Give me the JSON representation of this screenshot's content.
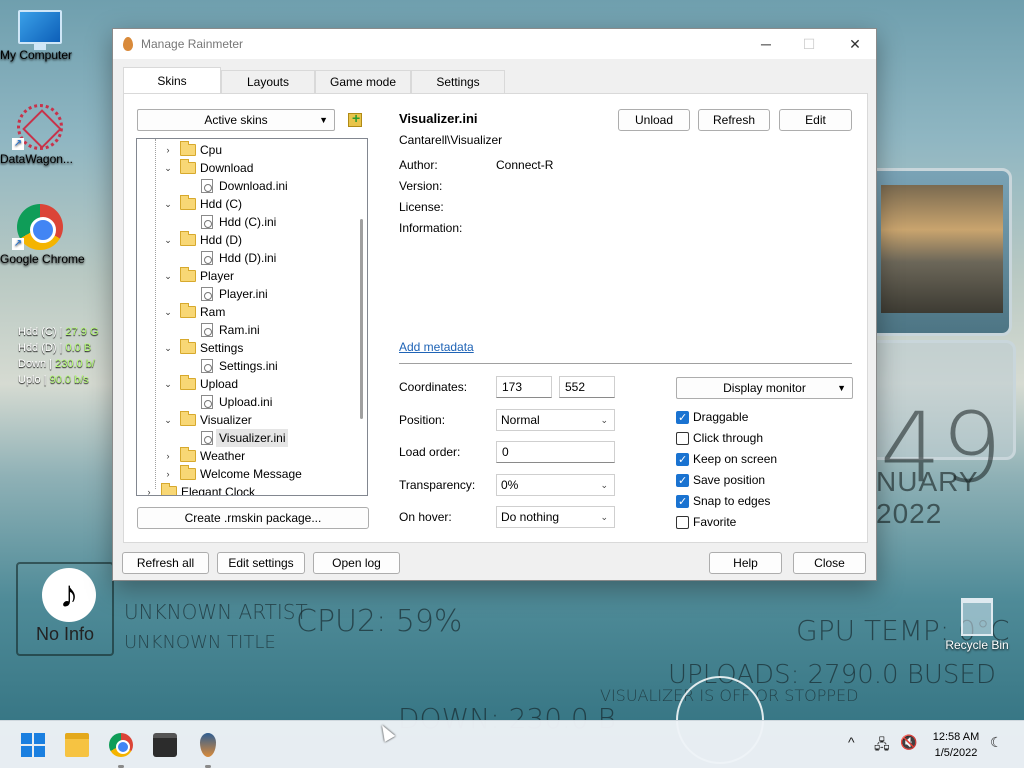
{
  "desktop": {
    "icons": [
      {
        "label": "My Computer"
      },
      {
        "label": "DataWagon..."
      },
      {
        "label": "Google Chrome"
      }
    ],
    "recycle_bin": "Recycle Bin",
    "stats": [
      {
        "label": "Hdd (C) |",
        "value": "27.9 G"
      },
      {
        "label": "Hdd (D) |",
        "value": "0.0 B"
      },
      {
        "label": "Down |",
        "value": "230.0 b/"
      },
      {
        "label": "Uplo |",
        "value": "90.0 b/s"
      }
    ],
    "big_clock": "49",
    "big_date": "NUARY 2022",
    "music": {
      "icon": "music-note-icon",
      "info": "No Info",
      "artist": "UNKNOWN ARTIST",
      "title": "UNKNOWN TITLE"
    },
    "cpu2": "CPU2: 59%",
    "gpu_temp": "GPU TEMP: 0°C",
    "down": "DOWN: 230.0 B",
    "upload_overlay": "UPLOADS: 2790.0 BUSED",
    "visualizer_overlay": "VISUALIZER IS OFF OR STOPPED"
  },
  "window": {
    "title": "Manage Rainmeter",
    "controls": {
      "minimize": "─",
      "maximize": "☐",
      "close": "✕"
    },
    "tabs": [
      "Skins",
      "Layouts",
      "Game mode",
      "Settings"
    ],
    "active_tab": "Skins",
    "skins_dropdown": "Active skins",
    "tree": [
      {
        "label": "Cpu",
        "type": "folder",
        "level": 1,
        "expanded": false
      },
      {
        "label": "Download",
        "type": "folder",
        "level": 1,
        "expanded": true
      },
      {
        "label": "Download.ini",
        "type": "file",
        "level": 2
      },
      {
        "label": "Hdd (C)",
        "type": "folder",
        "level": 1,
        "expanded": true
      },
      {
        "label": "Hdd (C).ini",
        "type": "file",
        "level": 2
      },
      {
        "label": "Hdd (D)",
        "type": "folder",
        "level": 1,
        "expanded": true
      },
      {
        "label": "Hdd (D).ini",
        "type": "file",
        "level": 2
      },
      {
        "label": "Player",
        "type": "folder",
        "level": 1,
        "expanded": true
      },
      {
        "label": "Player.ini",
        "type": "file",
        "level": 2
      },
      {
        "label": "Ram",
        "type": "folder",
        "level": 1,
        "expanded": true
      },
      {
        "label": "Ram.ini",
        "type": "file",
        "level": 2
      },
      {
        "label": "Settings",
        "type": "folder",
        "level": 1,
        "expanded": true
      },
      {
        "label": "Settings.ini",
        "type": "file",
        "level": 2
      },
      {
        "label": "Upload",
        "type": "folder",
        "level": 1,
        "expanded": true
      },
      {
        "label": "Upload.ini",
        "type": "file",
        "level": 2
      },
      {
        "label": "Visualizer",
        "type": "folder",
        "level": 1,
        "expanded": true
      },
      {
        "label": "Visualizer.ini",
        "type": "file",
        "level": 2,
        "selected": true
      },
      {
        "label": "Weather",
        "type": "folder",
        "level": 1,
        "expanded": false
      },
      {
        "label": "Welcome Message",
        "type": "folder",
        "level": 1,
        "expanded": false
      },
      {
        "label": "Elegant Clock",
        "type": "folder",
        "level": 0,
        "expanded": false
      }
    ],
    "create_package": "Create .rmskin package...",
    "skin": {
      "name": "Visualizer.ini",
      "path": "Cantarell\\Visualizer",
      "author_label": "Author:",
      "author": "Connect-R",
      "version_label": "Version:",
      "license_label": "License:",
      "information_label": "Information:",
      "add_metadata": "Add metadata"
    },
    "actions": {
      "unload": "Unload",
      "refresh": "Refresh",
      "edit": "Edit"
    },
    "settings": {
      "coordinates_label": "Coordinates:",
      "x": "173",
      "y": "552",
      "position_label": "Position:",
      "position": "Normal",
      "load_order_label": "Load order:",
      "load_order": "0",
      "transparency_label": "Transparency:",
      "transparency": "0%",
      "on_hover_label": "On hover:",
      "on_hover": "Do nothing",
      "display_monitor": "Display monitor"
    },
    "checkboxes": [
      {
        "label": "Draggable",
        "checked": true
      },
      {
        "label": "Click through",
        "checked": false
      },
      {
        "label": "Keep on screen",
        "checked": true
      },
      {
        "label": "Save position",
        "checked": true
      },
      {
        "label": "Snap to edges",
        "checked": true
      },
      {
        "label": "Favorite",
        "checked": false
      }
    ],
    "footer": {
      "refresh_all": "Refresh all",
      "edit_settings": "Edit settings",
      "open_log": "Open log",
      "help": "Help",
      "close": "Close"
    }
  },
  "taskbar": {
    "apps": [
      "start-icon",
      "file-explorer-icon",
      "chrome-icon",
      "store-icon",
      "rainmeter-icon"
    ],
    "tray": {
      "chevron": "^",
      "network": "🖧",
      "volume": "🔇",
      "moon": "☾"
    },
    "time": "12:58 AM",
    "date": "1/5/2022"
  }
}
